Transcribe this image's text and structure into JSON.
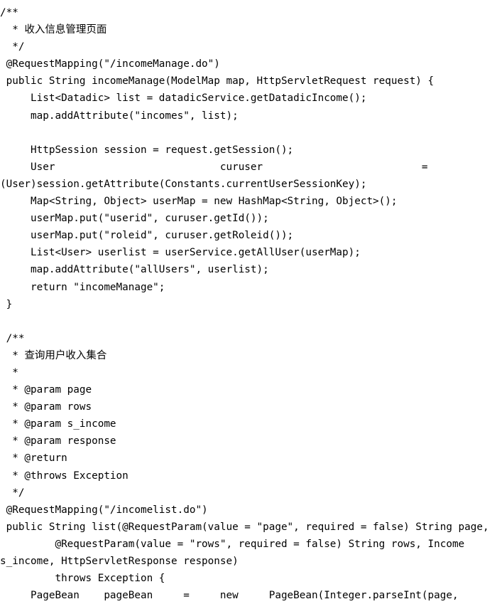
{
  "document": {
    "type": "java-source-code-screenshot",
    "language": "Java",
    "lines": [
      "/**",
      "  * 收入信息管理页面",
      "  */",
      " @RequestMapping(\"/incomeManage.do\")",
      " public String incomeManage(ModelMap map, HttpServletRequest request) {",
      "     List<Datadic> list = datadicService.getDatadicIncome();",
      "     map.addAttribute(\"incomes\", list);",
      "",
      "     HttpSession session = request.getSession();",
      "     User                           curuser                          =",
      "(User)session.getAttribute(Constants.currentUserSessionKey);",
      "     Map<String, Object> userMap = new HashMap<String, Object>();",
      "     userMap.put(\"userid\", curuser.getId());",
      "     userMap.put(\"roleid\", curuser.getRoleid());",
      "     List<User> userlist = userService.getAllUser(userMap);",
      "     map.addAttribute(\"allUsers\", userlist);",
      "     return \"incomeManage\";",
      " }",
      "",
      " /**",
      "  * 查询用户收入集合",
      "  *",
      "  * @param page",
      "  * @param rows",
      "  * @param s_income",
      "  * @param response",
      "  * @return",
      "  * @throws Exception",
      "  */",
      " @RequestMapping(\"/incomelist.do\")",
      " public String list(@RequestParam(value = \"page\", required = false) String page,",
      "         @RequestParam(value = \"rows\", required = false) String rows, Income",
      "s_income, HttpServletResponse response)",
      "         throws Exception {",
      "     PageBean    pageBean     =     new     PageBean(Integer.parseInt(page,"
    ]
  }
}
